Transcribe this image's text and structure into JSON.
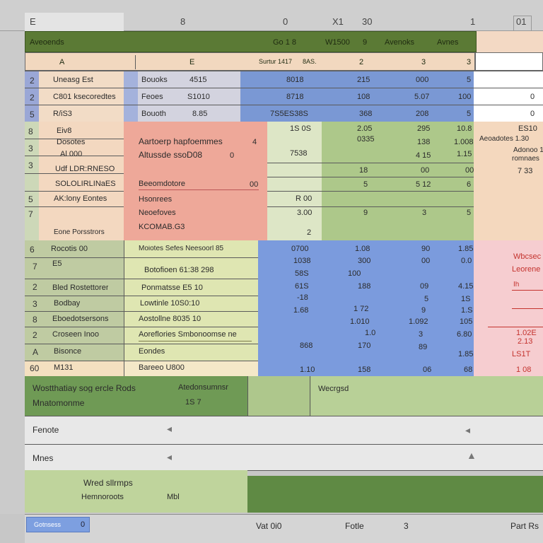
{
  "col_header": {
    "a": "E",
    "b": "8",
    "c": "0",
    "d": "X1",
    "e": "30",
    "f": "1",
    "g": "01"
  },
  "title_row": {
    "name": "Aveoends",
    "c1": "Go 1 8",
    "c2": "W1500",
    "c3": "9",
    "c4": "Avenoks",
    "c5": "Avnes"
  },
  "col_labels": {
    "a": "A",
    "b": "E",
    "c": "Surtur 1417",
    "d": "8AS.",
    "e": "2",
    "f": "3",
    "g": "3"
  },
  "top_block": [
    {
      "n": "2",
      "label": "Uneasg Est",
      "name": "Bouoks",
      "code": "4515",
      "v1": "8018",
      "v2": "215",
      "v3": "000",
      "v4": "5",
      "right": ""
    },
    {
      "n": "2",
      "label": "C801 ksecoredtes",
      "name": "Feoes",
      "code": "S1010",
      "v1": "8718",
      "v2": "108",
      "v3": "5.07",
      "v4": "100",
      "right": "0"
    },
    {
      "n": "5",
      "label": "R/iS3",
      "name": "Bouoth",
      "code": "8.85",
      "v1": "7S5ES38S",
      "v2": "368",
      "v3": "208",
      "v4": "5",
      "right": "0"
    }
  ],
  "mid_block": {
    "rows": [
      {
        "n": "8",
        "label": "Eiv8"
      },
      {
        "n": "3",
        "label": "Dosotes"
      },
      {
        "n": "3",
        "label": "Al 000"
      },
      {
        "n": "",
        "label": "Udf LDR:RNESO"
      },
      {
        "n": "5",
        "label": "SOLOLIRLINaES"
      },
      {
        "n": "7",
        "label": "AK:lony Eontes"
      }
    ],
    "footer_label": "Eone Porsstrors",
    "pink_lines": [
      "Aartoerp hapfoemmes",
      "Altussde ssoD08",
      "Beeomdotore",
      "Hsonrees",
      "Neoefoves",
      "KCOMAB.G3"
    ],
    "pink_side": [
      "4",
      "0",
      "00"
    ],
    "v1": [
      "1S 0S",
      "7538",
      "",
      "",
      "R 00",
      "3.00",
      "2"
    ],
    "v2": [
      "2.05",
      "0335",
      "18",
      "5",
      "9",
      ""
    ],
    "v3": [
      "295",
      "138",
      "4 15",
      "00",
      "5 12",
      "3"
    ],
    "v4": [
      "10.8",
      "1.008",
      "1.15",
      "00",
      "6",
      "5"
    ],
    "right_lines": [
      "ES10",
      "Aeoadotes 1.30",
      "Adonoo 13",
      "romnaes",
      "7 33"
    ]
  },
  "lower_block": {
    "rows": [
      {
        "n": "6",
        "label": "Rocotis 00",
        "name": "Moiotes Sefes Neesoorl 85"
      },
      {
        "n": "7",
        "label": "E5",
        "name": "Botofioen 61:38 298"
      },
      {
        "n": "2",
        "label": "Bled Rostettorer",
        "name": "Ponmatsse E5 10"
      },
      {
        "n": "3",
        "label": "Bodbay",
        "name": "Lowtinle 10S0:10"
      },
      {
        "n": "8",
        "label": "Eboedotsersons",
        "name": "Aostollne 8035 10"
      },
      {
        "n": "2",
        "label": "Croseen Inoo",
        "name": "Aoreflories Smbonoomse ne"
      },
      {
        "n": "A",
        "label": "Bisonce",
        "name": "Eondes"
      },
      {
        "n": "60",
        "label": "M131",
        "name": "Bareeo U800"
      }
    ],
    "v1": [
      "0700",
      "1038",
      "58S",
      "61S",
      "-18",
      "1.68",
      "",
      "868",
      "1.10"
    ],
    "v2": [
      "1.08",
      "300",
      "100",
      "188",
      "1 72",
      "1.010",
      "1.0",
      "170",
      "158"
    ],
    "v3": [
      "90",
      "00",
      "09",
      "5",
      "9",
      "1.092",
      "3",
      "89",
      "06"
    ],
    "v4": [
      "1.85",
      "0.0",
      "4.15",
      "1S",
      "1.S",
      "105",
      "6.80",
      "1.85",
      "68"
    ],
    "right_lines": [
      "Wbcsec",
      "Leorene",
      "Ih",
      "",
      "",
      "1.02E",
      "2.13",
      "LS1T",
      "1 08"
    ]
  },
  "panel1": {
    "left_title": "Wostthatiay sog ercle Rods",
    "left_sub": "Mnatomonme",
    "mid_title": "Atedonsumnsr",
    "mid_val": "1S 7",
    "right_title": "Wecrgsd"
  },
  "panel2": {
    "row1": "Fenote",
    "row2": "Mnes"
  },
  "panel3": {
    "title": "Wred sllrmps",
    "sub": "Hemnoroots",
    "val": "Mbl"
  },
  "status": {
    "tab": "Gotnsess",
    "tab_val": "0",
    "c1": "Vat 0i0",
    "c2": "Fotle",
    "c3": "3",
    "c4": "Part Rs"
  }
}
